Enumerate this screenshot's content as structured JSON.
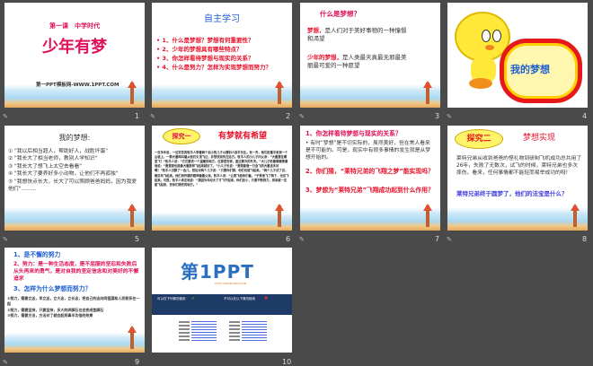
{
  "slides": [
    {
      "num": "1",
      "subtitle": "第一课　中学时代",
      "title": "少年有梦",
      "footer": "第一PPT模板网-WWW.1PPT.COM"
    },
    {
      "num": "2",
      "title": "自主学习",
      "items": [
        "• 1、什么是梦想？梦想有何重要性？",
        "• 2、少年的梦想具有哪些特点？",
        "• 3、你怎样看待梦想与现实的关系？",
        "• 4、什么是努力？怎样为实现梦想而努力？"
      ]
    },
    {
      "num": "3",
      "title": "什么是梦想？",
      "p1_label": "梦想，",
      "p1": "是人们对于美好事物的一种憧憬和渴望",
      "p2_label": "少年的梦想，",
      "p2": "是人类最天真最无邪最美丽最可爱的一种愿望"
    },
    {
      "num": "4",
      "title": "我的梦想"
    },
    {
      "num": "5",
      "title": "我的梦想:",
      "items": [
        "① \"我以后相当超人，帮助好人，战胜坏蛋\"",
        "② \"我长大了相当老师，教别人学知识\"",
        "③ \"我长大了想飞上太空去看看\"",
        "④ \"我长大了要养好多小动物，让他们不再孤独\"",
        "⑤ \"我想快点长大，长大了可以照顾爸爸妈妈，因为我爱他们\"………"
      ]
    },
    {
      "num": "6",
      "badge": "探究一",
      "title": "有梦就有希望",
      "body": "一百多年前，一位穷苦的牧羊人带着两个幼小的儿子以替别人放羊为生。有一天，他们赶着羊来到一个山坡上，一群大雁鸣叫着从他们头顶飞过，并很快消失在远方。牧羊人的小儿子问父亲：“大雁要往哪里飞？”牧羊人说：“它们要去一个温暖的地方，在那里安家，度过寒冷的冬天。”大儿子眨着眼睛羡慕地说：“要是我也能像大雁那样飞起来就好了。”小儿子也说：“要是能做一只会飞的大雁该多好啊！”牧羊人沉默了一会儿，然后对两个儿子说：“只要你们想，你们也能飞起来。”两个儿子试了试，都没有飞起来。他们用怀疑的眼神看着父亲。牧羊人说：“让我飞给你们看。”于是他飞了两下，也没飞起来。可是，牧羊人肯定地说：“我因为年纪大了才飞不起来，你们还小，只要不断努力，将来就一定能飞起来，去你们想去的地方。”"
    },
    {
      "num": "7",
      "q1": "1、你怎样看待梦想与现实的关系？",
      "a1": "• 有时“梦想”是不切实际的，虽然美好，但在常人看来是不可能的。可是，现实中有很多事情的发生就是从梦想开始的。",
      "q2": "2、你们猜，“莱特兄弟的飞翔之梦”能实现吗？",
      "q3": "3、梦想为“莱特兄弟”飞翔成功起到什么作用？"
    },
    {
      "num": "8",
      "badge": "探究二",
      "title": "梦想实现",
      "body": "莱特兄弟从收到爸爸的怪礼物到研制飞机成功总共用了26年，失败了无数次，试飞的时候，莱特兄弟也多次摔伤。看来，任何事情都不能轻而易举成功的呀!",
      "question": "莱特兄弟终于圆梦了，他们的法宝是什么？"
    },
    {
      "num": "9",
      "h1": "1、是不懈的努力",
      "h2": "2、努力：是一种生活态度，是不屈服的坚忍和失败后从头再来的勇气，是对自我的坚定信念和对美好的不懈追求",
      "h3": "3、怎样为什么梦想而努力？",
      "items": [
        "①努力，需要立志，早立志，立大志，立长志，把自己的志向同祖国和人民联系在一起",
        "②努力，需要坚持，只要坚持，多大的绊脚石也会变成垫脚石",
        "③努力，需要方法，方法对了就会起到事半功倍的效果"
      ]
    },
    {
      "num": "10",
      "logo": "第1PPT",
      "url": "HTTP://WWW.1PPT.COM",
      "col1": "可以在下列情况使用",
      "col2": "不可以在以下情况使用"
    }
  ]
}
